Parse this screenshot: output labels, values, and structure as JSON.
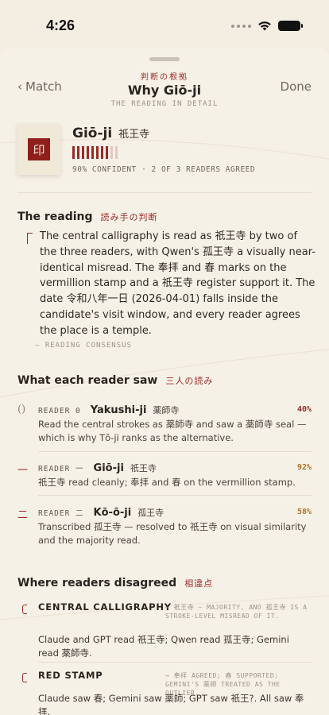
{
  "status": {
    "time": "4:26"
  },
  "nav": {
    "back_label": "Match",
    "done_label": "Done",
    "kanji": "判断の根拠",
    "title": "Why Giō-ji",
    "subtitle": "THE READING IN DETAIL"
  },
  "header": {
    "seal": "印",
    "name": "Giō-ji",
    "kanji": "祇王寺",
    "confidence": 0.9,
    "meta": "90% CONFIDENT · 2 OF 3 READERS AGREED"
  },
  "reading": {
    "title": "The reading",
    "title_jp": "読み手の判断",
    "text": "The central calligraphy is read as 祇王寺 by two of the three readers, with Qwen's 孤王寺 a visually near-identical misread. The 奉拝 and 春 marks on the vermillion stamp and a 祇王寺 register support it. The date 令和八年一日 (2026-04-01) falls inside the candidate's visit window, and every reader agrees the place is a temple.",
    "footer": "— READING CONSENSUS"
  },
  "readers_section": {
    "title": "What each reader saw",
    "title_jp": "三人の読み"
  },
  "readers": [
    {
      "mark": "()",
      "label": "READER 0",
      "name": "Yakushi-ji",
      "kanji": "薬師寺",
      "pct": "40%",
      "pct_color": "#9b2a26",
      "desc": "Read the central strokes as 薬師寺 and saw a 薬師寺 seal — which is why Tō-ji ranks as the alternative."
    },
    {
      "mark": "一",
      "label": "READER 一",
      "name": "Giō-ji",
      "kanji": "祇王寺",
      "pct": "92%",
      "pct_color": "#b0722a",
      "desc": "祇王寺 read cleanly; 奉拝 and 春 on the vermillion stamp."
    },
    {
      "mark": "二",
      "label": "READER 二",
      "name": "Kō-ō-ji",
      "kanji": "孤王寺",
      "pct": "58%",
      "pct_color": "#b0722a",
      "desc": "Transcribed 孤王寺 — resolved to 祇王寺 on visual similarity and the majority read."
    }
  ],
  "disagree_section": {
    "title": "Where readers disagreed",
    "title_jp": "相違点"
  },
  "disagreements": [
    {
      "head": "CENTRAL CALLIGRAPHY",
      "note": "→ 祇王寺 — MAJORITY, AND 孤王寺 IS A STROKE-LEVEL MISREAD OF IT.",
      "desc": "Claude and GPT read 祇王寺; Qwen read 孤王寺; Gemini read 薬師寺."
    },
    {
      "head": "RED STAMP",
      "note": "→ 奉拝 AGREED; 春 SUPPORTED; GEMINI'S 薬師 TREATED AS THE OUTLIER.",
      "desc": "Claude saw 春; Gemini saw 薬師; GPT saw 祇王?. All saw 奉拝."
    }
  ]
}
